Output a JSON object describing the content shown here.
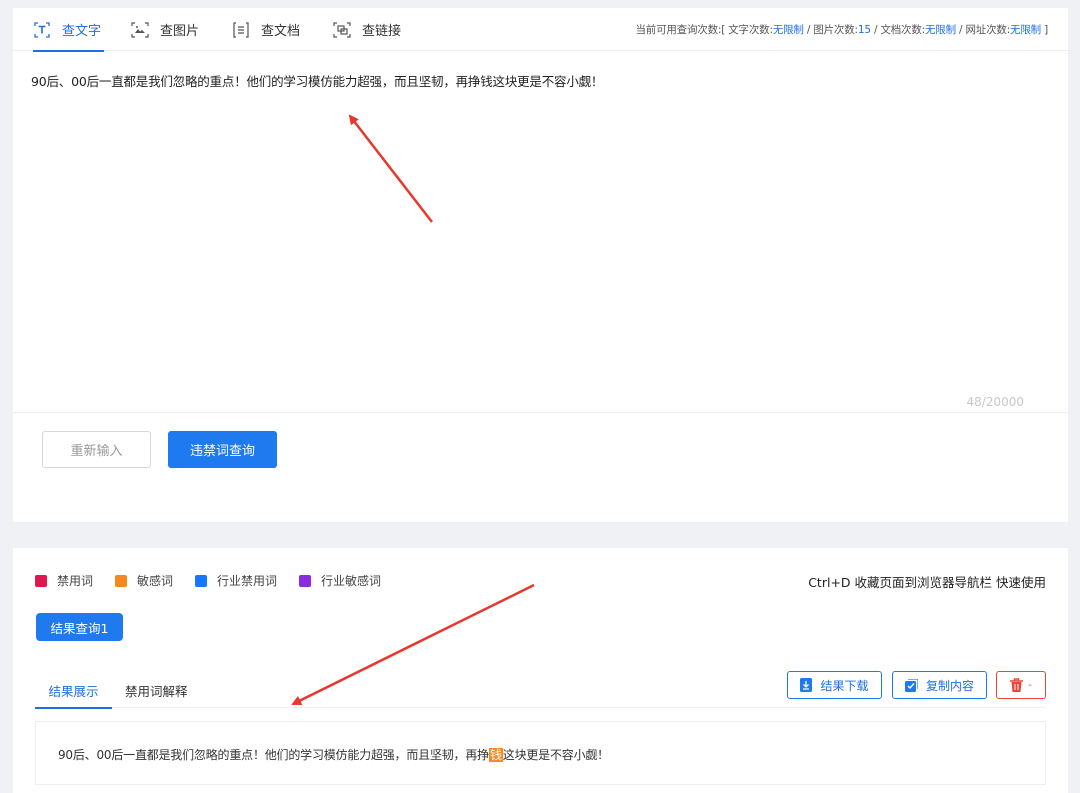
{
  "tabs": [
    {
      "label": "查文字",
      "icon": "text-icon",
      "active": true
    },
    {
      "label": "查图片",
      "icon": "image-icon",
      "active": false
    },
    {
      "label": "查文档",
      "icon": "document-icon",
      "active": false
    },
    {
      "label": "查链接",
      "icon": "link-icon",
      "active": false
    }
  ],
  "quota": {
    "prefix": "当前可用查询次数:[ 文字次数:",
    "text_count": "无限制",
    "sep1": " / 图片次数:",
    "image_count": "15",
    "sep2": " / 文档次数:",
    "doc_count": "无限制",
    "sep3": " / 网址次数:",
    "url_count": "无限制",
    "suffix": " ]"
  },
  "input": {
    "text": "90后、00后一直都是我们忽略的重点！他们的学习模仿能力超强，而且坚韧，再挣钱这块更是不容小觑！",
    "counter": "48/20000"
  },
  "buttons": {
    "reset": "重新输入",
    "query": "违禁词查询"
  },
  "legend": [
    {
      "label": "禁用词",
      "color": "#e0174e"
    },
    {
      "label": "敏感词",
      "color": "#f5891f"
    },
    {
      "label": "行业禁用词",
      "color": "#1677ff"
    },
    {
      "label": "行业敏感词",
      "color": "#8a2be2"
    }
  ],
  "shortcut_hint": "Ctrl+D 收藏页面到浏览器导航栏 快速使用",
  "result_tag": "结果查询1",
  "sub_tabs": {
    "result": "结果展示",
    "explain": "禁用词解释"
  },
  "tools": {
    "download": "结果下载",
    "copy": "复制内容",
    "delete_caret": "-"
  },
  "result": {
    "before": "90后、00后一直都是我们忽略的重点！他们的学习模仿能力超强，而且坚韧，再挣",
    "highlight": "钱",
    "after": "这块更是不容小觑！"
  },
  "colors": {
    "accent": "#1f7af0",
    "danger": "#e8453c",
    "highlight": "#f08a24",
    "annotation_arrow": "#e8372c"
  }
}
